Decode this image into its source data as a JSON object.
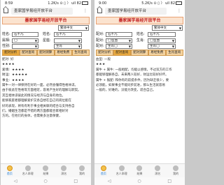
{
  "left": {
    "status": {
      "time": "8:59",
      "info": "1.2K/s ⊙ ▯ 〉 ull 82"
    },
    "url": "墨家国学易经开放平台",
    "menu_glyph": "⋮",
    "site_title": "墨家国学易经开放平台",
    "language": "繁体中文",
    "rows": [
      {
        "label": "姓名:",
        "field1": "石不凡",
        "label2": "姓名:",
        "field2": "石不凡"
      },
      {
        "label": "属相:",
        "field1": "◯",
        "label2": "星座:",
        "field2": ""
      },
      {
        "label": "性别:",
        "field1": "",
        "label2": "",
        "field2": "生肖"
      }
    ],
    "buttons": [
      "配对分析",
      "配对查询",
      "配对测算",
      "易经免费",
      "生肖查询"
    ],
    "content": [
      "配对: 好",
      "★★★★",
      "爱情: ★★★★",
      "财运: ★★★★★",
      "事业: ★★★★",
      "属牛一对一律保持在好的一面，必然会懂得性格体谅。",
      "由于彼此在性格等方面相近，容易产生好的理解与默契。",
      "其互相体谅彼此的情况与经济与自身的地位。",
      "能够家庭者都理解爱护又各自想在自己的岗位能在",
      "好的表现，将有有利于事业相关联的结合与支持各自",
      "们。婚姻生活都是不错的两方面都能合家相好对",
      "方的。在他们的身体，也需要多注意保健，"
    ],
    "tabs": [
      {
        "label": "首页",
        "icon": "home-icon",
        "active": true
      },
      {
        "label": "名人命理",
        "icon": "person-icon",
        "active": false
      },
      {
        "label": "结果",
        "icon": "result-icon",
        "active": false
      },
      {
        "label": "测名",
        "icon": "name-icon",
        "active": false
      },
      {
        "label": "我的",
        "icon": "user-icon",
        "active": false
      }
    ],
    "nav": [
      "◁",
      "○",
      "□"
    ]
  },
  "right": {
    "status": {
      "time": "9:00",
      "info": "5.2K/s ⊙ ▯ 〉 ull 82"
    },
    "url": "墨家国学易经开放平台",
    "menu_glyph": "⋮",
    "site_title": "墨家国学易经开放平台",
    "language": "繁体中文",
    "rows": [
      {
        "label": "配对:",
        "field1": "石不凡",
        "label2": "姓名:",
        "field2": "石不凡"
      },
      {
        "label": "配对:",
        "field1": "◯型血",
        "label2": "生肖:",
        "field2": "◯型血"
      },
      {
        "label": "配对:",
        "field1": "生肖◯",
        "label2": "",
        "field2": "生肖◯"
      }
    ],
    "buttons": [
      "配对分析",
      "配对查询",
      "配对测算",
      "易经免费",
      "生肖查询"
    ],
    "content": [
      "血型: 一般",
      "★★★",
      "属牛 + 属牛: 一般相配，均能以感情，不过双方的工作",
      "都能够理解各自，未来两人较好，财运比较好好坏。",
      "属牛 + 猴配: 和你有的前提条件，因为缺乏很少，要",
      "必须能，如果事业不能同步前进，那么生活就容易",
      "一般的，好难的，没能力改变，适合自己。"
    ],
    "tabs": [
      {
        "label": "首页",
        "icon": "home-icon",
        "active": true
      },
      {
        "label": "名人命理",
        "icon": "person-icon",
        "active": false
      },
      {
        "label": "结果",
        "icon": "result-icon",
        "active": false
      },
      {
        "label": "测名",
        "icon": "name-icon",
        "active": false
      },
      {
        "label": "我的",
        "icon": "user-icon",
        "active": false
      }
    ],
    "nav": [
      "◁",
      "○",
      "□"
    ]
  }
}
